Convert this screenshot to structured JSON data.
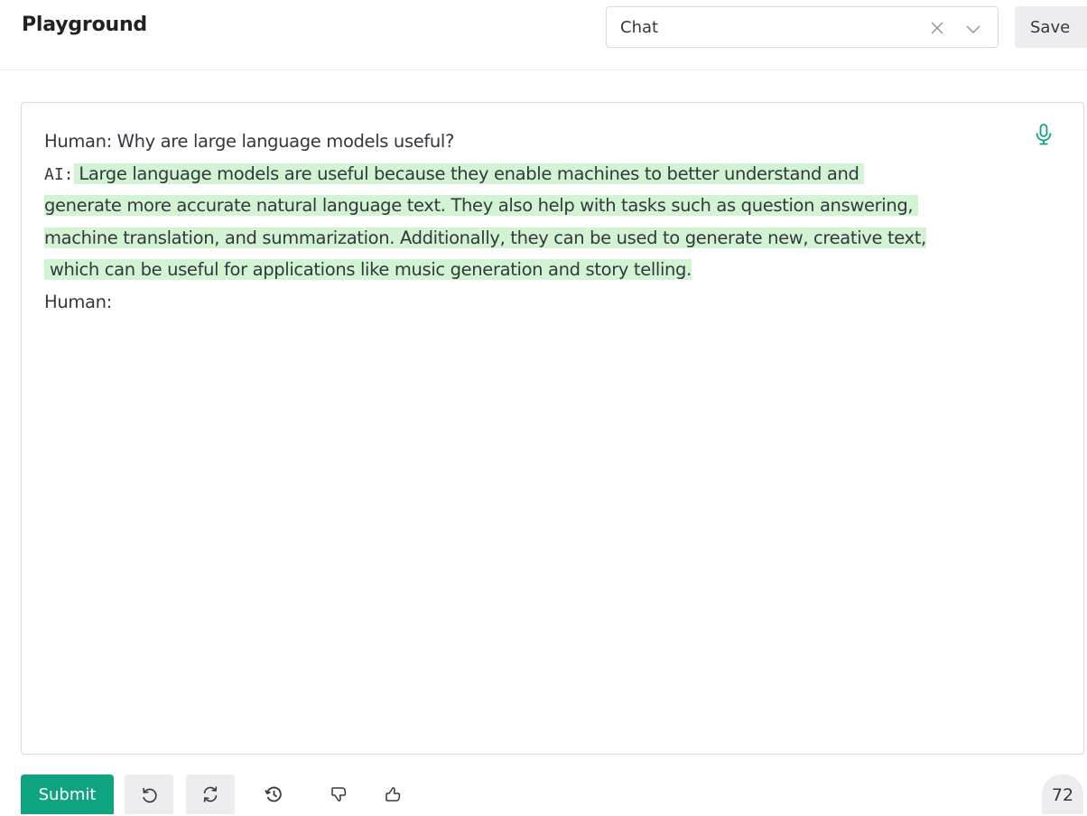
{
  "header": {
    "title": "Playground",
    "preset": {
      "value": "Chat",
      "clear_icon": "close-icon",
      "dropdown_icon": "chevron-down-icon"
    },
    "save_label": "Save"
  },
  "editor": {
    "mic_icon": "microphone-icon",
    "human_question": "Human: Why are large language models useful?",
    "ai_prefix": "AI:",
    "ai_lines": [
      " Large language models are useful because they enable machines to better understand and ",
      "generate more accurate natural language text. They also help with tasks such as question answering, ",
      "machine translation, and summarization. Additionally, they can be used to generate new, creative text,",
      " which can be useful for applications like music generation and story telling."
    ],
    "human_next": "Human:",
    "highlight_color": "#d2f4d3"
  },
  "footer": {
    "submit_label": "Submit",
    "buttons": [
      {
        "name": "undo",
        "icon": "undo-icon"
      },
      {
        "name": "regenerate",
        "icon": "refresh-icon"
      },
      {
        "name": "history",
        "icon": "history-icon"
      },
      {
        "name": "thumbs-down",
        "icon": "thumbs-down-icon"
      },
      {
        "name": "thumbs-up",
        "icon": "thumbs-up-icon"
      }
    ],
    "token_count": "72"
  },
  "colors": {
    "accent": "#10a37f",
    "text": "#353740",
    "border": "#d9d9e3",
    "button_bg": "#ececf1"
  }
}
